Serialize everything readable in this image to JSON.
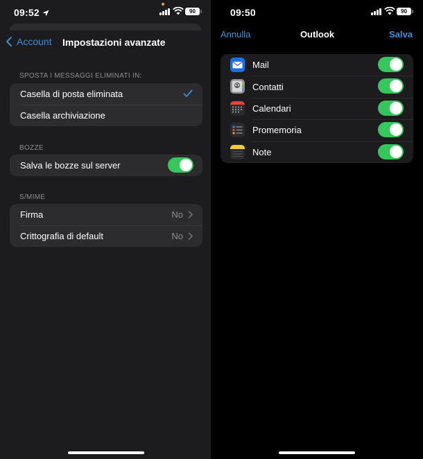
{
  "left": {
    "status": {
      "time": "09:52",
      "battery": "90"
    },
    "nav": {
      "back_label": "Account",
      "title": "Impostazioni avanzate"
    },
    "deleted_section": {
      "header": "SPOSTA I MESSAGGI ELIMINATI IN:",
      "options": [
        {
          "label": "Casella di posta eliminata",
          "selected": true
        },
        {
          "label": "Casella archiviazione",
          "selected": false
        }
      ]
    },
    "drafts_section": {
      "header": "BOZZE",
      "row": {
        "label": "Salva le bozze sul server",
        "on": true
      }
    },
    "smime_section": {
      "header": "S/MIME",
      "rows": [
        {
          "label": "Firma",
          "value": "No"
        },
        {
          "label": "Crittografia di default",
          "value": "No"
        }
      ]
    }
  },
  "right": {
    "status": {
      "time": "09:50",
      "battery": "90"
    },
    "nav": {
      "cancel": "Annulla",
      "title": "Outlook",
      "save": "Salva"
    },
    "apps": [
      {
        "label": "Mail",
        "icon": "mail-app-icon",
        "on": true
      },
      {
        "label": "Contatti",
        "icon": "contacts-app-icon",
        "on": true
      },
      {
        "label": "Calendari",
        "icon": "calendar-app-icon",
        "on": true
      },
      {
        "label": "Promemoria",
        "icon": "reminders-app-icon",
        "on": true
      },
      {
        "label": "Note",
        "icon": "notes-app-icon",
        "on": true
      }
    ]
  },
  "colors": {
    "accent": "#3d8fd8",
    "toggle_on": "#34c759",
    "group_bg": "#2c2c2e",
    "secondary_text": "#8e8e93"
  }
}
